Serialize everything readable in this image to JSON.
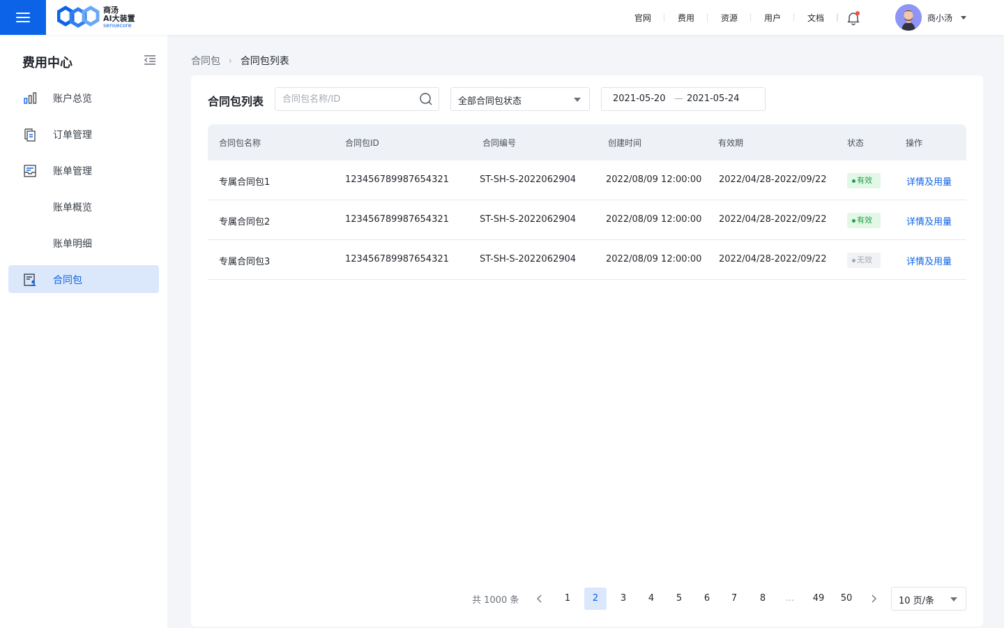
{
  "brand": {
    "line1": "商汤",
    "line2": "AI大装置",
    "line3": "sensecore",
    "accent": "#0c63e7"
  },
  "topnav": {
    "items": [
      "官网",
      "费用",
      "资源",
      "用户",
      "文档"
    ],
    "username": "商小汤"
  },
  "sidebar": {
    "title": "费用中心",
    "items": [
      {
        "label": "账户总览",
        "icon": "bar-chart-icon"
      },
      {
        "label": "订单管理",
        "icon": "order-list-icon"
      },
      {
        "label": "账单管理",
        "icon": "bill-tray-icon"
      },
      {
        "label": "账单概览",
        "icon": ""
      },
      {
        "label": "账单明细",
        "icon": ""
      },
      {
        "label": "合同包",
        "icon": "contract-user-icon"
      }
    ]
  },
  "breadcrumb": {
    "parent": "合同包",
    "current": "合同包列表"
  },
  "main": {
    "title": "合同包列表",
    "search_placeholder": "合同包名称/ID",
    "status_filter": "全部合同包状态",
    "date_start": "2021-05-20",
    "date_sep": "—",
    "date_end": "2021-05-24"
  },
  "table": {
    "headers": [
      "合同包名称",
      "合同包ID",
      "合同编号",
      "创建时间",
      "有效期",
      "状态",
      "操作"
    ],
    "rows": [
      {
        "name": "专属合同包1",
        "id": "123456789987654321",
        "code": "ST-SH-S-2022062904",
        "created": "2022/08/09 12:00:00",
        "period": "2022/04/28-2022/09/22",
        "status": "有效",
        "action": "详情及用量"
      },
      {
        "name": "专属合同包2",
        "id": "123456789987654321",
        "code": "ST-SH-S-2022062904",
        "created": "2022/08/09 12:00:00",
        "period": "2022/04/28-2022/09/22",
        "status": "有效",
        "action": "详情及用量"
      },
      {
        "name": "专属合同包3",
        "id": "123456789987654321",
        "code": "ST-SH-S-2022062904",
        "created": "2022/08/09 12:00:00",
        "period": "2022/04/28-2022/09/22",
        "status": "无效",
        "action": "详情及用量"
      }
    ]
  },
  "pagination": {
    "total": "共 1000 条",
    "pages": [
      "1",
      "2",
      "3",
      "4",
      "5",
      "6",
      "7",
      "8",
      "...",
      "49",
      "50"
    ],
    "current": "2",
    "page_size": "10 页/条"
  }
}
